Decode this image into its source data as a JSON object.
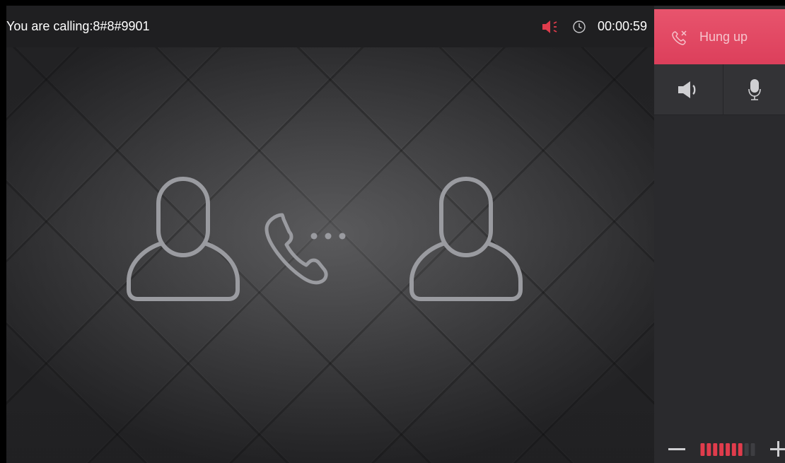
{
  "call": {
    "calling_label": "You are calling:8#8#9901",
    "timer": "00:00:59"
  },
  "controls": {
    "hangup_label": "Hung up"
  },
  "volume": {
    "level": 7,
    "max": 9
  },
  "icons": {
    "status": [
      "speaker-alert-icon",
      "clock-icon"
    ],
    "stage": [
      "person-icon",
      "phone-ringing-icon",
      "person-icon"
    ],
    "panel": [
      "phone-hangup-icon",
      "speaker-icon",
      "microphone-icon",
      "minus-icon",
      "plus-icon"
    ]
  },
  "colors": {
    "accent": "#e84a65",
    "alert": "#e03c4c",
    "icon_outline": "#9a9ba0",
    "text": "#ffffff"
  }
}
